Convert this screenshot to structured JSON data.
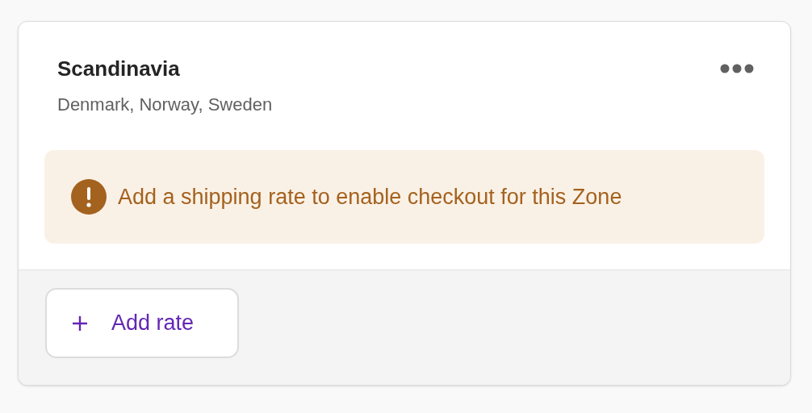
{
  "zone": {
    "title": "Scandinavia",
    "countries": "Denmark, Norway, Sweden"
  },
  "alert": {
    "kind": "warning",
    "message": "Add a shipping rate to enable checkout for this Zone"
  },
  "footer": {
    "button": "Add rate"
  }
}
